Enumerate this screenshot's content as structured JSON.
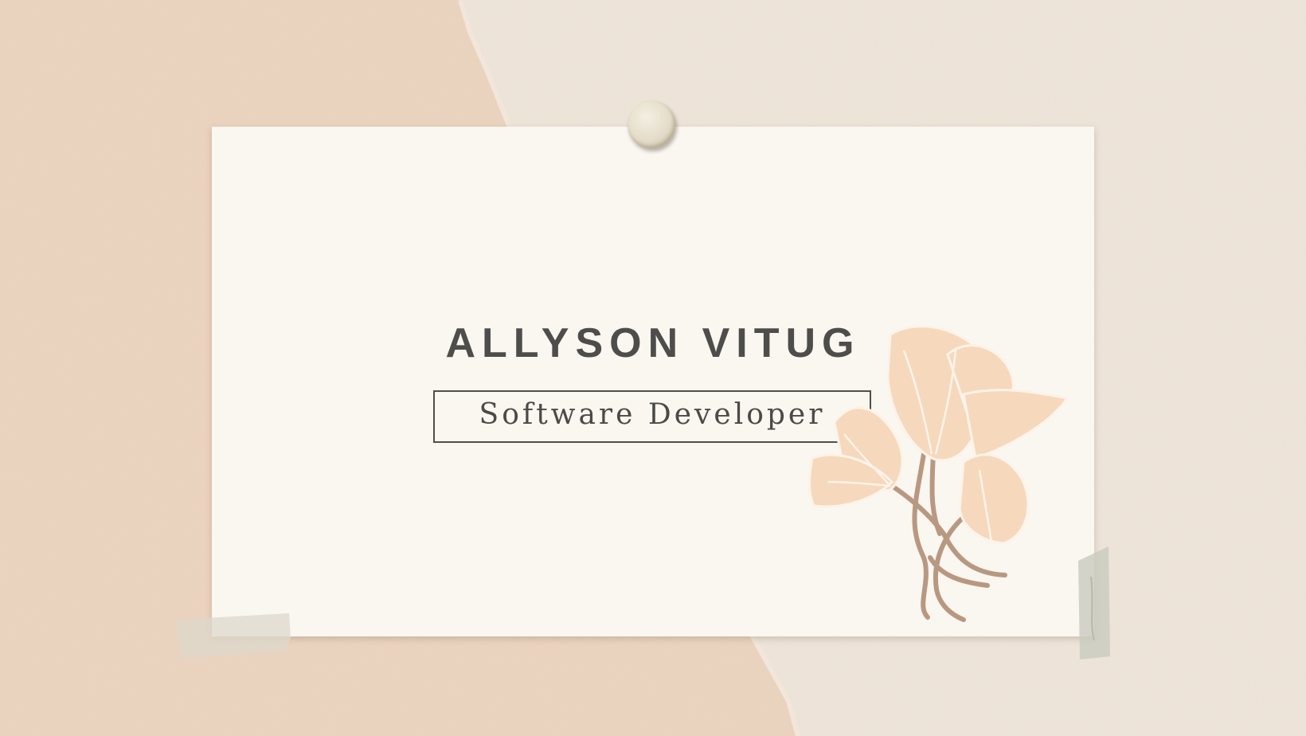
{
  "card": {
    "name": "ALLYSON VITUG",
    "role": "Software Developer"
  },
  "colors": {
    "background_left": "#ecd4bf",
    "background_right": "#efe6db",
    "card": "#faf6f0",
    "text": "#4d4d4b",
    "flower_petal": "#f6d8bd",
    "flower_stem": "#b89881"
  },
  "icons": {
    "pin": "pushpin-icon",
    "flower": "magnolia-flower-illustration",
    "tape": "masking-tape"
  }
}
